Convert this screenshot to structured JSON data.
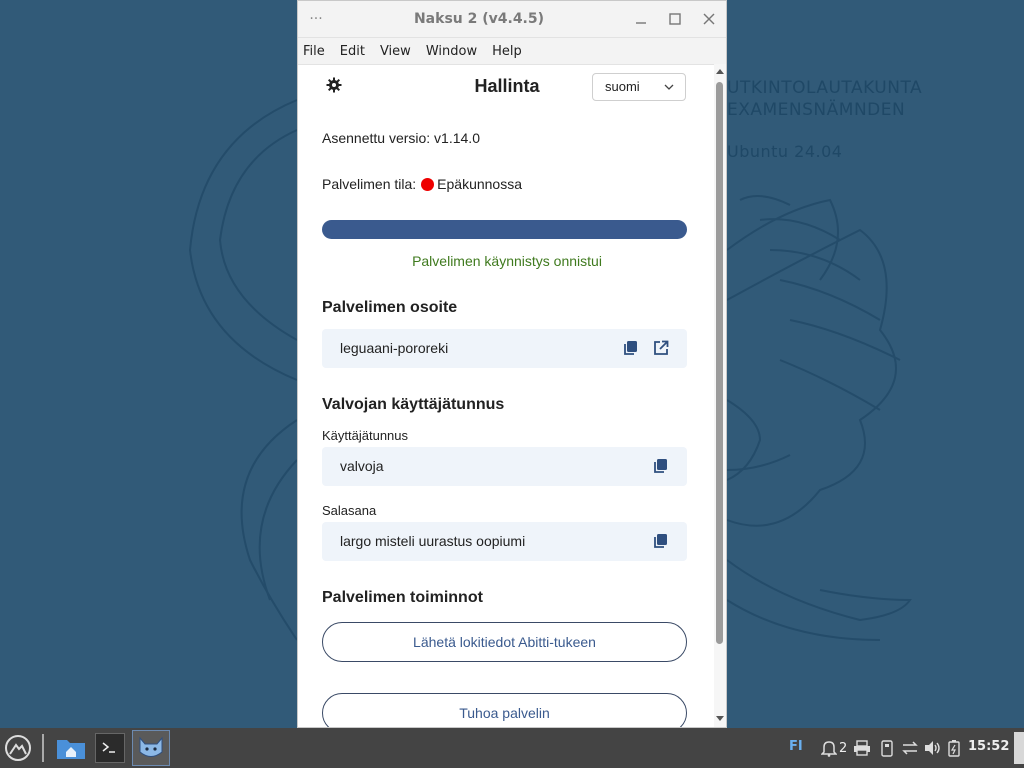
{
  "desktop": {
    "line1": "UTKINTOLAUTAKUNTA",
    "line2": "EXAMENSNÄMNDEN",
    "os": "Ubuntu 24.04"
  },
  "window": {
    "title": "Naksu 2 (v4.4.5)",
    "dots": "···",
    "minimize": "—",
    "maximize": "☐",
    "close": "✕"
  },
  "menu": [
    "File",
    "Edit",
    "View",
    "Window",
    "Help"
  ],
  "header": {
    "title": "Hallinta",
    "language": "suomi",
    "language_chev": "⌵"
  },
  "version_label": "Asennettu versio: v1.14.0",
  "status": {
    "label": "Palvelimen tila:",
    "value": "Epäkunnossa",
    "color": "#e00000"
  },
  "progress": {
    "value": 1.0,
    "color": "#3a5a8e"
  },
  "success_message": "Palvelimen käynnistys onnistui",
  "address": {
    "heading": "Palvelimen osoite",
    "value": "leguaani-pororeki"
  },
  "supervisor": {
    "heading": "Valvojan käyttäjätunnus",
    "username_label": "Käyttäjätunnus",
    "username": "valvoja",
    "password_label": "Salasana",
    "password": "largo misteli uurastus oopiumi"
  },
  "actions": {
    "heading": "Palvelimen toiminnot",
    "send_logs": "Lähetä lokitiedot Abitti-tukeen",
    "destroy": "Tuhoa palvelin"
  },
  "taskbar": {
    "keyboard_layout": "FI",
    "notifications": "2",
    "clock": "15:52"
  },
  "colors": {
    "desktop": "#315a78",
    "accent": "#3a5a8e",
    "success": "#3f7a1e",
    "taskbar": "#444444"
  }
}
